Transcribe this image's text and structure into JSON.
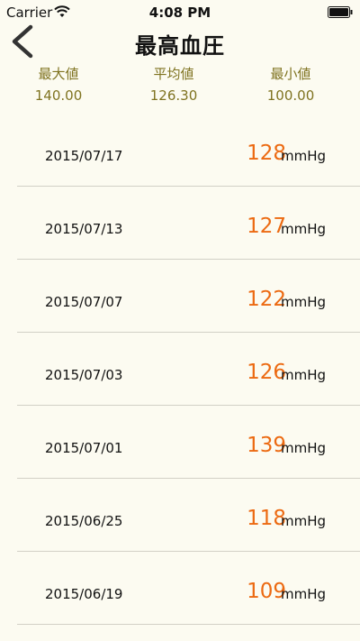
{
  "status_bar": {
    "carrier": "Carrier",
    "time": "4:08 PM"
  },
  "nav": {
    "title": "最高血圧",
    "back_icon": "chevron-left-icon"
  },
  "stats": {
    "max_label": "最大値",
    "max_value": "140.00",
    "avg_label": "平均値",
    "avg_value": "126.30",
    "min_label": "最小値",
    "min_value": "100.00",
    "color": "#7f7320"
  },
  "records": [
    {
      "date": "2015/07/17",
      "value": "128",
      "unit": "mmHg"
    },
    {
      "date": "2015/07/13",
      "value": "127",
      "unit": "mmHg"
    },
    {
      "date": "2015/07/07",
      "value": "122",
      "unit": "mmHg"
    },
    {
      "date": "2015/07/03",
      "value": "126",
      "unit": "mmHg"
    },
    {
      "date": "2015/07/01",
      "value": "139",
      "unit": "mmHg"
    },
    {
      "date": "2015/06/25",
      "value": "118",
      "unit": "mmHg"
    },
    {
      "date": "2015/06/19",
      "value": "109",
      "unit": "mmHg"
    }
  ],
  "colors": {
    "background": "#fcfbf1",
    "accent_value": "#ec6a12",
    "separator": "#d2d0c6"
  }
}
